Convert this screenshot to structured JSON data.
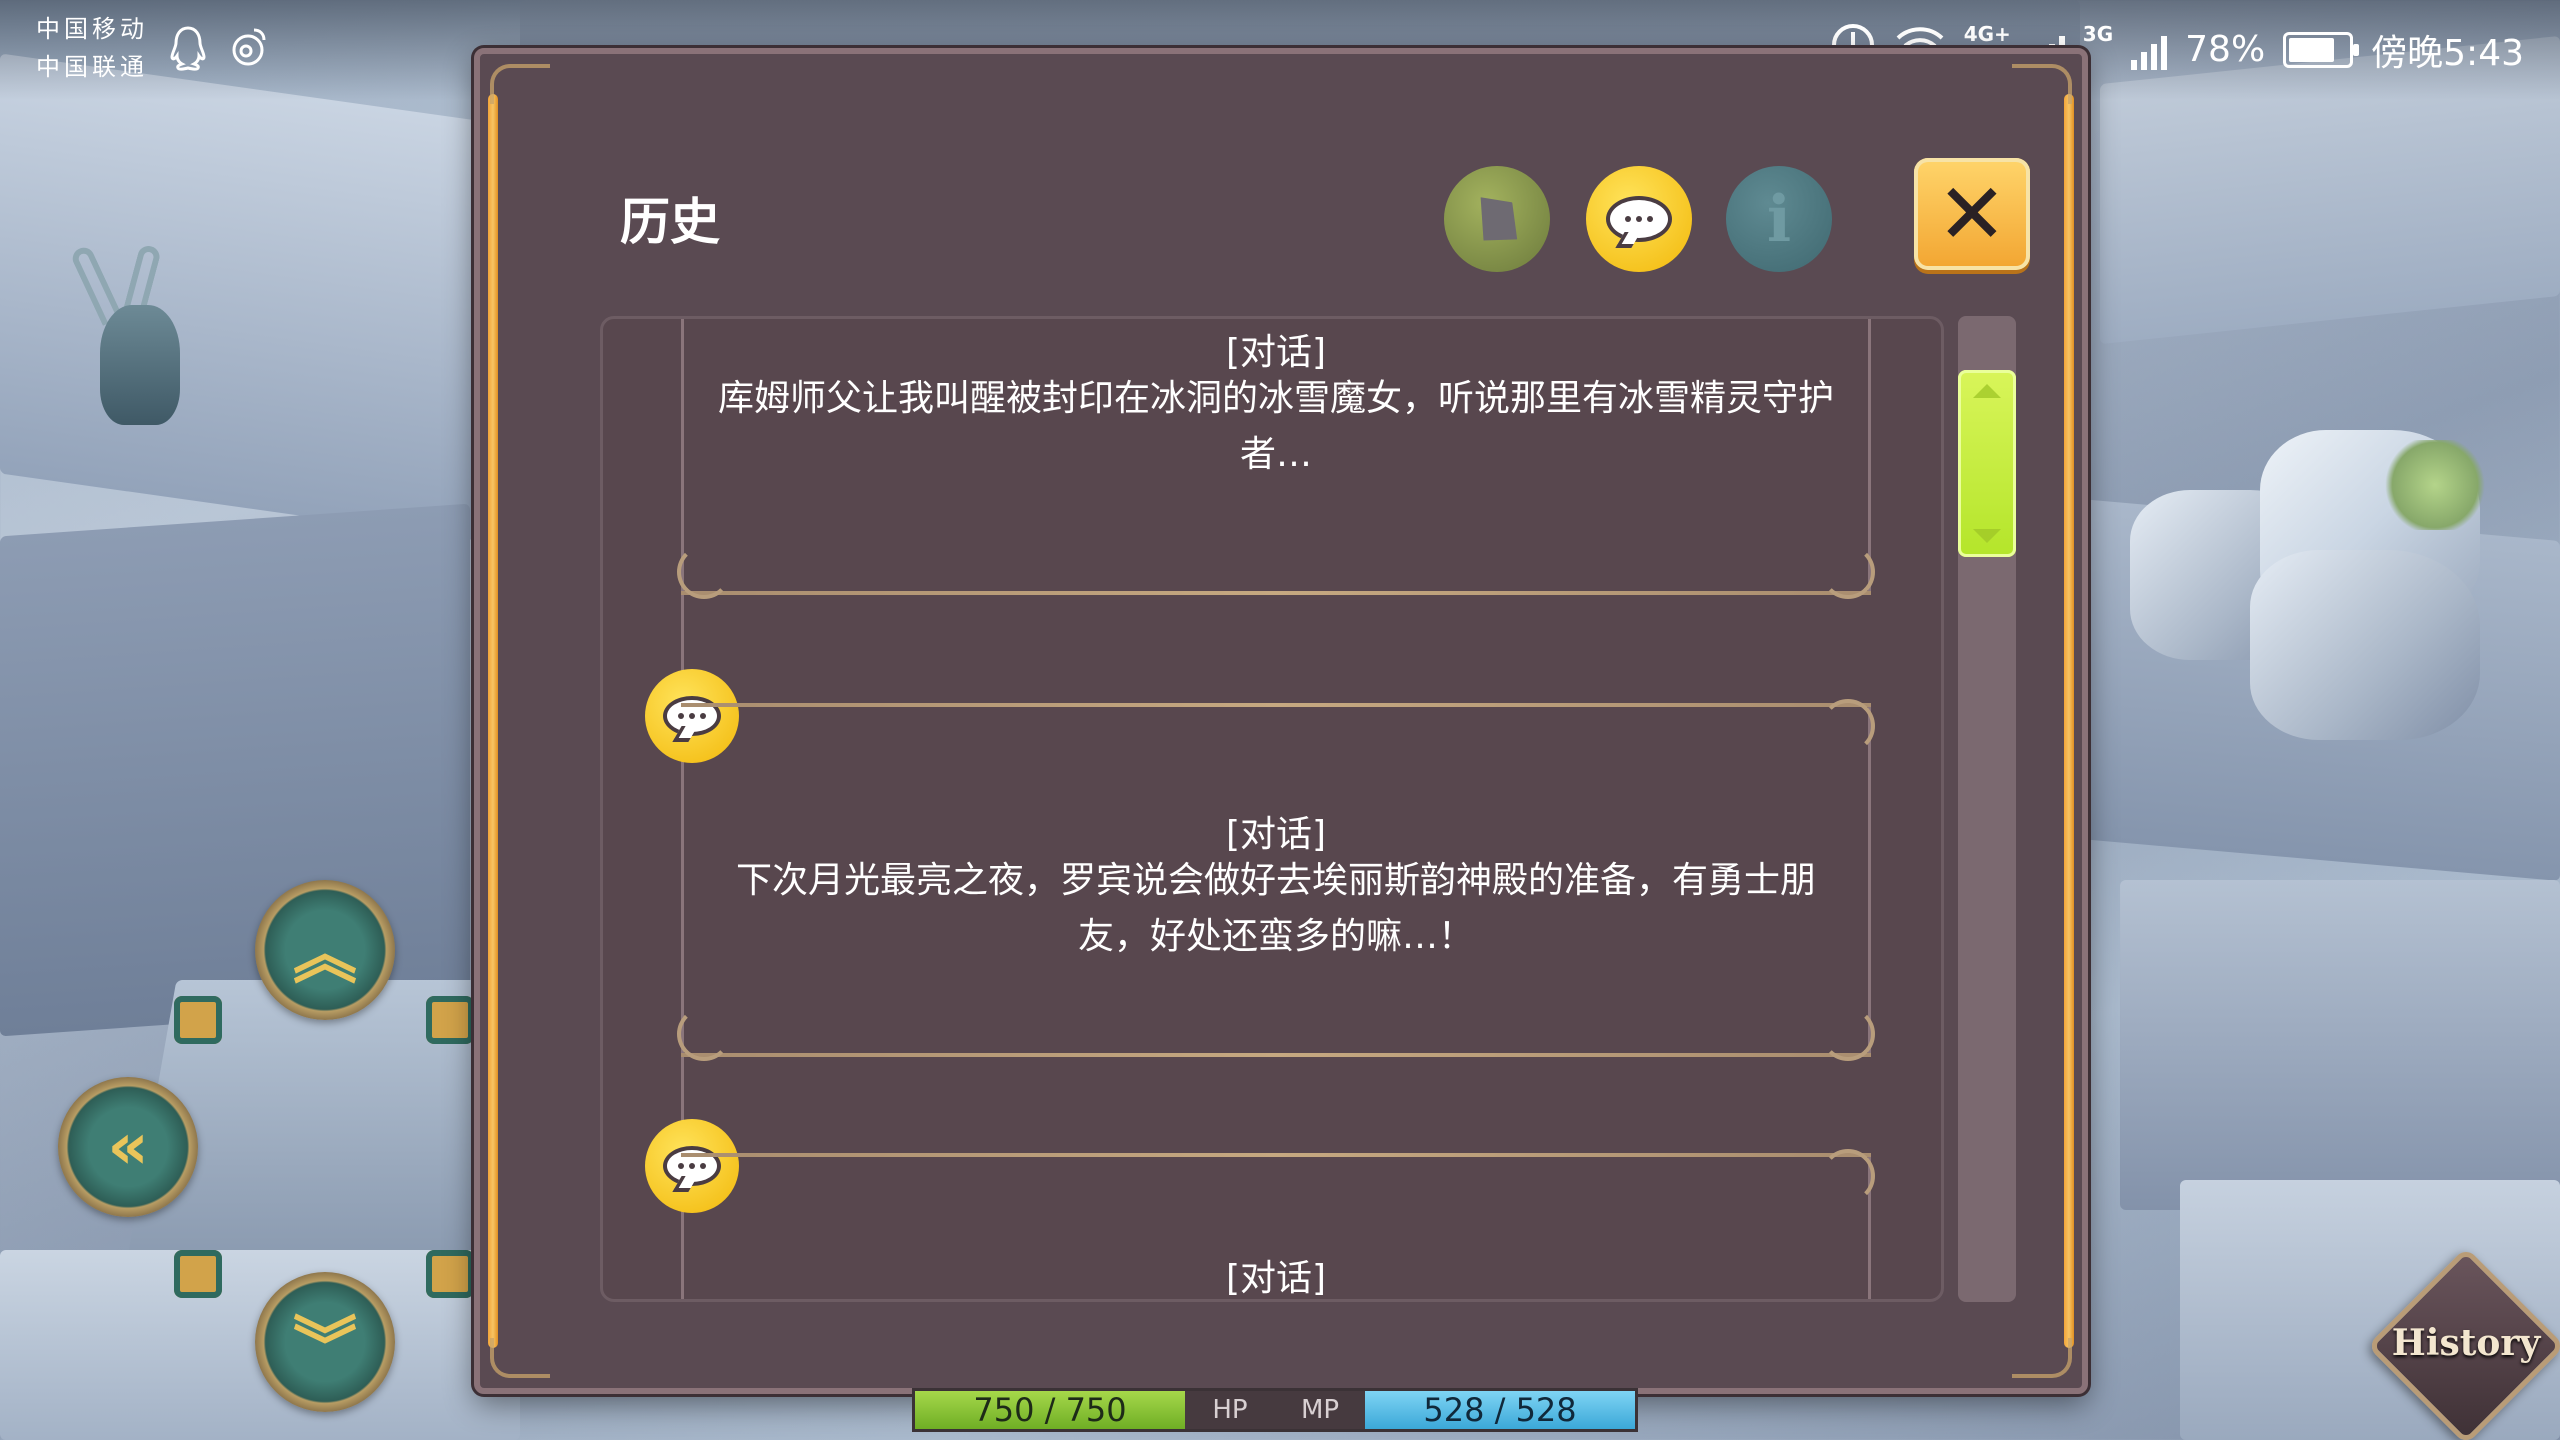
{
  "status_bar": {
    "carrier_1": "中国移动",
    "carrier_2": "中国联通",
    "net_1": "4G+",
    "net_2": "3G",
    "battery_percent": "78%",
    "battery_level": 0.78,
    "time": "傍晚5:43",
    "icons": [
      "qq-icon",
      "weibo-icon",
      "sync-icon",
      "wifi-icon",
      "signal-icon",
      "battery-icon"
    ]
  },
  "panel": {
    "title": "历史",
    "tabs": [
      {
        "icon": "pen-icon",
        "active": false
      },
      {
        "icon": "speech-bubble-icon",
        "active": true
      },
      {
        "icon": "info-icon",
        "label": "i",
        "active": false
      }
    ],
    "close_label": "✕",
    "entries": [
      {
        "tag": "[对话]",
        "text": "库姆师父让我叫醒被封印在冰洞的冰雪魔女，听说那里有冰雪精灵守护者…"
      },
      {
        "tag": "[对话]",
        "text": "下次月光最亮之夜，罗宾说会做好去埃丽斯韵神殿的准备，有勇士朋友，好处还蛮多的嘛…！"
      },
      {
        "tag": "[对话]",
        "text": ""
      }
    ],
    "scroll_position": 0.0,
    "scroll_thumb_fraction": 0.19
  },
  "stats": {
    "hp": "750 / 750",
    "hp_label": "HP",
    "mp_label": "MP",
    "mp": "528 / 528"
  },
  "history_button": {
    "label": "History"
  },
  "colors": {
    "panel_bg": "#5a4a52",
    "accent_yellow": "#f2b80a",
    "rail_orange": "#f2a43a",
    "scroll_green": "#c6ee40"
  }
}
